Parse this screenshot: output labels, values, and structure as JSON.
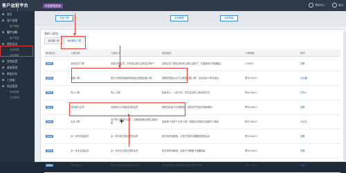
{
  "header": {
    "brand": "客户运营平台",
    "badge": "市场营销系统",
    "right_items": [
      "帮助中心",
      "退出"
    ]
  },
  "sidebar": {
    "items": [
      {
        "label": "首页",
        "sub": false,
        "active": false
      },
      {
        "label": "客户管理",
        "sub": false,
        "active": false
      },
      {
        "label": "客户视图",
        "sub": true,
        "active": false
      },
      {
        "label": "客户分群",
        "sub": false,
        "active": true
      },
      {
        "label": "客户标签",
        "sub": true,
        "active": false
      },
      {
        "label": "营销活动",
        "sub": false,
        "active": false
      },
      {
        "label": "活动列表",
        "sub": true,
        "active": false
      },
      {
        "label": "活动模板",
        "sub": true,
        "active": false
      },
      {
        "label": "营销配置",
        "sub": false,
        "active": false
      },
      {
        "label": "渠道管理",
        "sub": false,
        "active": false
      },
      {
        "label": "数据分析",
        "sub": false,
        "active": false
      },
      {
        "label": "工具箱",
        "sub": false,
        "active": false
      },
      {
        "label": "权益管理",
        "sub": false,
        "active": false
      },
      {
        "label": "系统设置",
        "sub": true,
        "active": false
      },
      {
        "label": "日志查询",
        "sub": true,
        "active": false
      }
    ]
  },
  "toolbar": {
    "buttons": [
      "全部人群",
      "全部管理",
      "全部场景"
    ]
  },
  "panel": {
    "title": "我的人群包",
    "tabs": [
      "我创建人群",
      "我收藏的人群"
    ]
  },
  "table": {
    "headers": [
      "使用状态",
      "人群名称",
      "人群定义",
      "规则描述",
      "人群规模",
      "操作"
    ],
    "rows": [
      {
        "status": "NEW",
        "name": "全部会员人群",
        "def": "全部注册会员，已完成注册认证的会员用户",
        "desc": "全部会员人群包含所有注册认证用户，可直接用于营销触达",
        "size": "11000+",
        "op": "查看"
      },
      {
        "status": "NEW",
        "name": "创建人群",
        "def": "按行为规则或画像标签组合筛选创建人群",
        "desc": "按照标签组合与行为规则创建人群，支持自定义条件组合",
        "size": "预计3000人",
        "op": "去创建"
      },
      {
        "status": "NEW",
        "name": "导入人群",
        "def": "导入人群",
        "desc": "批量导入：上传文件，学生会员导入等多种方式",
        "size": "预计3000人",
        "op": "去导入"
      },
      {
        "status": "NEW",
        "name": "活动参与会员",
        "def": "近期参与过营销活动的会员",
        "desc": "按照活动参与记录圈选，可配合不同活动场景使用",
        "size": "预计4000人",
        "op": "查看"
      },
      {
        "status": "NEW",
        "name": "合并人群",
        "def": "对已有人群进行合并、交集或差集运算生成新人群",
        "desc": "选择两个或多个已有人群，按照合并规则生成新的人群包",
        "size": "预计3000人",
        "op": "去合并"
      },
      {
        "status": "NEW",
        "name": "近一年有交易会员",
        "def": "近一年内有交易记录的会员",
        "desc": "按交易时间圈选，可用于复购与唤醒类营销活动",
        "size": "预计5000人",
        "op": "查看"
      },
      {
        "status": "NEW",
        "name": "近一年未交易会员",
        "def": "近一年内无交易记录的会员",
        "desc": "按交易时间圈选，适用于沉睡客户唤醒场景",
        "size": "预计4000人",
        "op": "查看"
      },
      {
        "status": "NEW",
        "name": "高价值会员",
        "def": "累计消费金额较高的核心会员",
        "desc": "按消费金额与频次圈选的高价值客户群体",
        "size": "预计2000人",
        "op": "查看"
      }
    ]
  }
}
